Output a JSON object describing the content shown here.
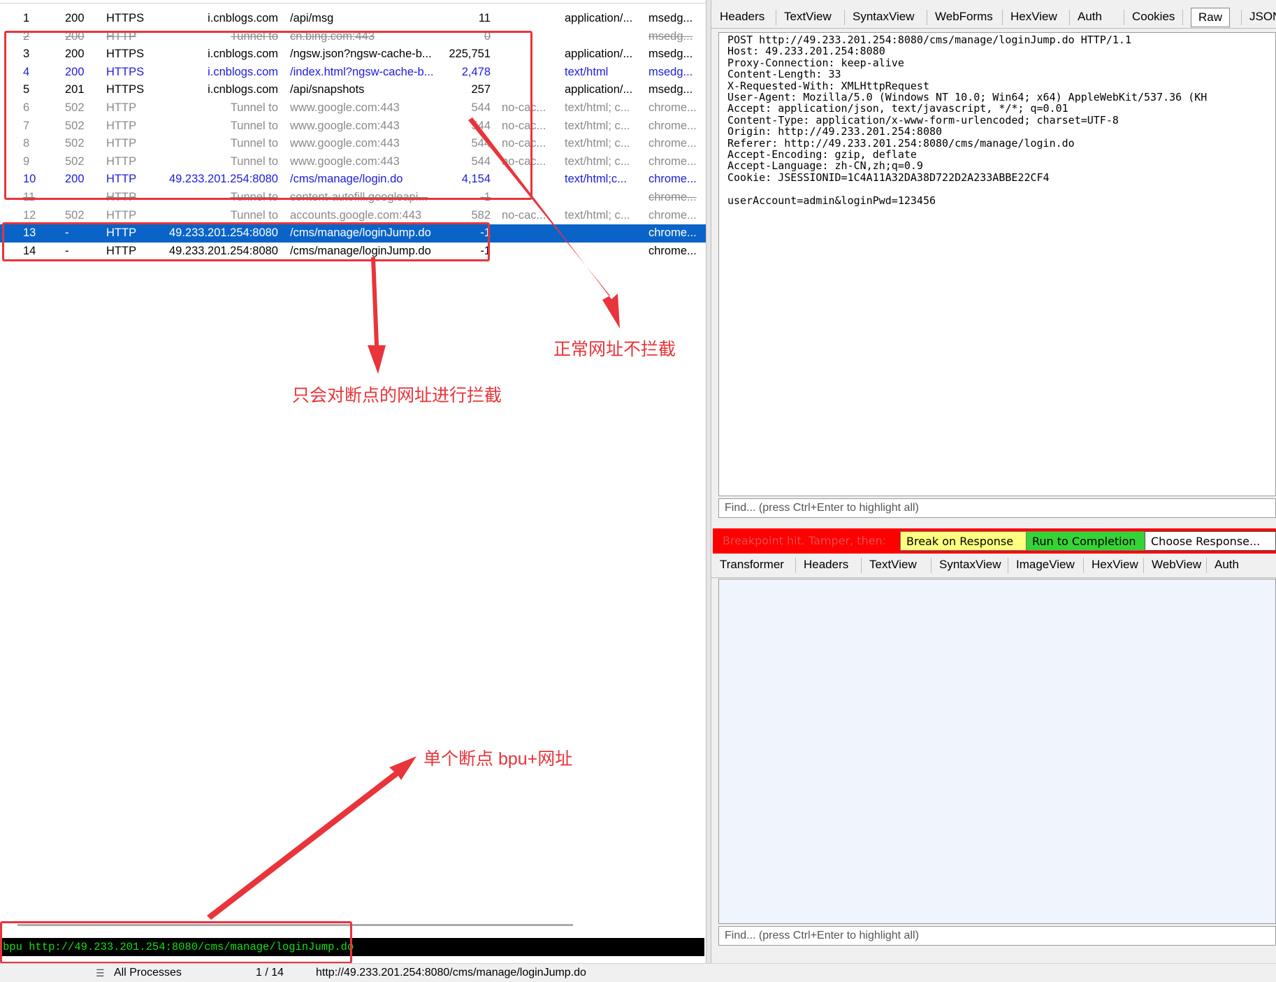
{
  "sessions": [
    {
      "num": "1",
      "result": "200",
      "protocol": "HTTPS",
      "host": "i.cnblogs.com",
      "url": "/api/msg",
      "body": "11",
      "caching": "",
      "ctype": "application/...",
      "process": "msedg...",
      "icon": "js-icon",
      "style": "normal"
    },
    {
      "num": "2",
      "result": "200",
      "protocol": "HTTP",
      "host": "Tunnel to",
      "url": "cn.bing.com:443",
      "body": "0",
      "caching": "",
      "ctype": "",
      "process": "msedg...",
      "icon": "lock-icon",
      "style": "strike"
    },
    {
      "num": "3",
      "result": "200",
      "protocol": "HTTPS",
      "host": "i.cnblogs.com",
      "url": "/ngsw.json?ngsw-cache-b...",
      "body": "225,751",
      "caching": "",
      "ctype": "application/...",
      "process": "msedg...",
      "icon": "js-icon",
      "style": "normal"
    },
    {
      "num": "4",
      "result": "200",
      "protocol": "HTTPS",
      "host": "i.cnblogs.com",
      "url": "/index.html?ngsw-cache-b...",
      "body": "2,478",
      "caching": "",
      "ctype": "text/html",
      "process": "msedg...",
      "icon": "arrows-icon",
      "style": "blue"
    },
    {
      "num": "5",
      "result": "201",
      "protocol": "HTTPS",
      "host": "i.cnblogs.com",
      "url": "/api/snapshots",
      "body": "257",
      "caching": "",
      "ctype": "application/...",
      "process": "msedg...",
      "icon": "js-green-icon",
      "style": "normal"
    },
    {
      "num": "6",
      "result": "502",
      "protocol": "HTTP",
      "host": "Tunnel to",
      "url": "www.google.com:443",
      "body": "544",
      "caching": "no-cac...",
      "ctype": "text/html; c...",
      "process": "chrome...",
      "icon": "lock-icon",
      "style": "gray"
    },
    {
      "num": "7",
      "result": "502",
      "protocol": "HTTP",
      "host": "Tunnel to",
      "url": "www.google.com:443",
      "body": "544",
      "caching": "no-cac...",
      "ctype": "text/html; c...",
      "process": "chrome...",
      "icon": "lock-icon",
      "style": "gray"
    },
    {
      "num": "8",
      "result": "502",
      "protocol": "HTTP",
      "host": "Tunnel to",
      "url": "www.google.com:443",
      "body": "544",
      "caching": "no-cac...",
      "ctype": "text/html; c...",
      "process": "chrome...",
      "icon": "lock-icon",
      "style": "gray"
    },
    {
      "num": "9",
      "result": "502",
      "protocol": "HTTP",
      "host": "Tunnel to",
      "url": "www.google.com:443",
      "body": "544",
      "caching": "no-cac...",
      "ctype": "text/html; c...",
      "process": "chrome...",
      "icon": "lock-icon",
      "style": "gray"
    },
    {
      "num": "10",
      "result": "200",
      "protocol": "HTTP",
      "host": "49.233.201.254:8080",
      "url": "/cms/manage/login.do",
      "body": "4,154",
      "caching": "",
      "ctype": "text/html;c...",
      "process": "chrome...",
      "icon": "arrows-icon",
      "style": "blue"
    },
    {
      "num": "11",
      "result": "",
      "protocol": "HTTP",
      "host": "Tunnel to",
      "url": "content-autofill.googleapi...",
      "body": "-1",
      "caching": "",
      "ctype": "",
      "process": "chrome...",
      "icon": "upload-icon",
      "style": "strike"
    },
    {
      "num": "12",
      "result": "502",
      "protocol": "HTTP",
      "host": "Tunnel to",
      "url": "accounts.google.com:443",
      "body": "582",
      "caching": "no-cac...",
      "ctype": "text/html; c...",
      "process": "chrome...",
      "icon": "lock-icon",
      "style": "gray"
    },
    {
      "num": "13",
      "result": "-",
      "protocol": "HTTP",
      "host": "49.233.201.254:8080",
      "url": "/cms/manage/loginJump.do",
      "body": "-1",
      "caching": "",
      "ctype": "",
      "process": "chrome...",
      "icon": "breakpoint-icon",
      "style": "selected"
    },
    {
      "num": "14",
      "result": "-",
      "protocol": "HTTP",
      "host": "49.233.201.254:8080",
      "url": "/cms/manage/loginJump.do",
      "body": "-1",
      "caching": "",
      "ctype": "",
      "process": "chrome...",
      "icon": "breakpoint-icon",
      "style": "normal"
    }
  ],
  "annotations": {
    "normal_not_intercepted": "正常网址不拦截",
    "only_breakpoint_intercepted": "只会对断点的网址进行拦截",
    "single_breakpoint": "单个断点 bpu+网址"
  },
  "quickexec": {
    "command": "bpu http://49.233.201.254:8080/cms/manage/loginJump.do"
  },
  "statusbar": {
    "process_filter": "All Processes",
    "count": "1 / 14",
    "selected_url": "http://49.233.201.254:8080/cms/manage/loginJump.do"
  },
  "request_tabs": [
    "Headers",
    "TextView",
    "SyntaxView",
    "WebForms",
    "HexView",
    "Auth",
    "Cookies",
    "Raw",
    "JSON"
  ],
  "request_active_tab": "Raw",
  "raw_request": "POST http://49.233.201.254:8080/cms/manage/loginJump.do HTTP/1.1\nHost: 49.233.201.254:8080\nProxy-Connection: keep-alive\nContent-Length: 33\nX-Requested-With: XMLHttpRequest\nUser-Agent: Mozilla/5.0 (Windows NT 10.0; Win64; x64) AppleWebKit/537.36 (KH\nAccept: application/json, text/javascript, */*; q=0.01\nContent-Type: application/x-www-form-urlencoded; charset=UTF-8\nOrigin: http://49.233.201.254:8080\nReferer: http://49.233.201.254:8080/cms/manage/login.do\nAccept-Encoding: gzip, deflate\nAccept-Language: zh-CN,zh;q=0.9\nCookie: JSESSIONID=1C4A11A32DA38D722D2A233ABBE22CF4\n\nuserAccount=admin&loginPwd=123456",
  "find_placeholder": "Find... (press Ctrl+Enter to highlight all)",
  "breakpoint_bar": {
    "message": "Breakpoint hit. Tamper, then:",
    "break_on_response": "Break on Response",
    "run_to_completion": "Run to Completion",
    "choose_response": "Choose Response..."
  },
  "response_tabs": [
    "Transformer",
    "Headers",
    "TextView",
    "SyntaxView",
    "ImageView",
    "HexView",
    "WebView",
    "Auth"
  ],
  "colors": {
    "selection": "#0a64c8",
    "annotation": "#e8343a",
    "breakpoint_bar": "#ff0000",
    "quickexec_text": "#12e012",
    "link_blue": "#1c1cdc"
  }
}
